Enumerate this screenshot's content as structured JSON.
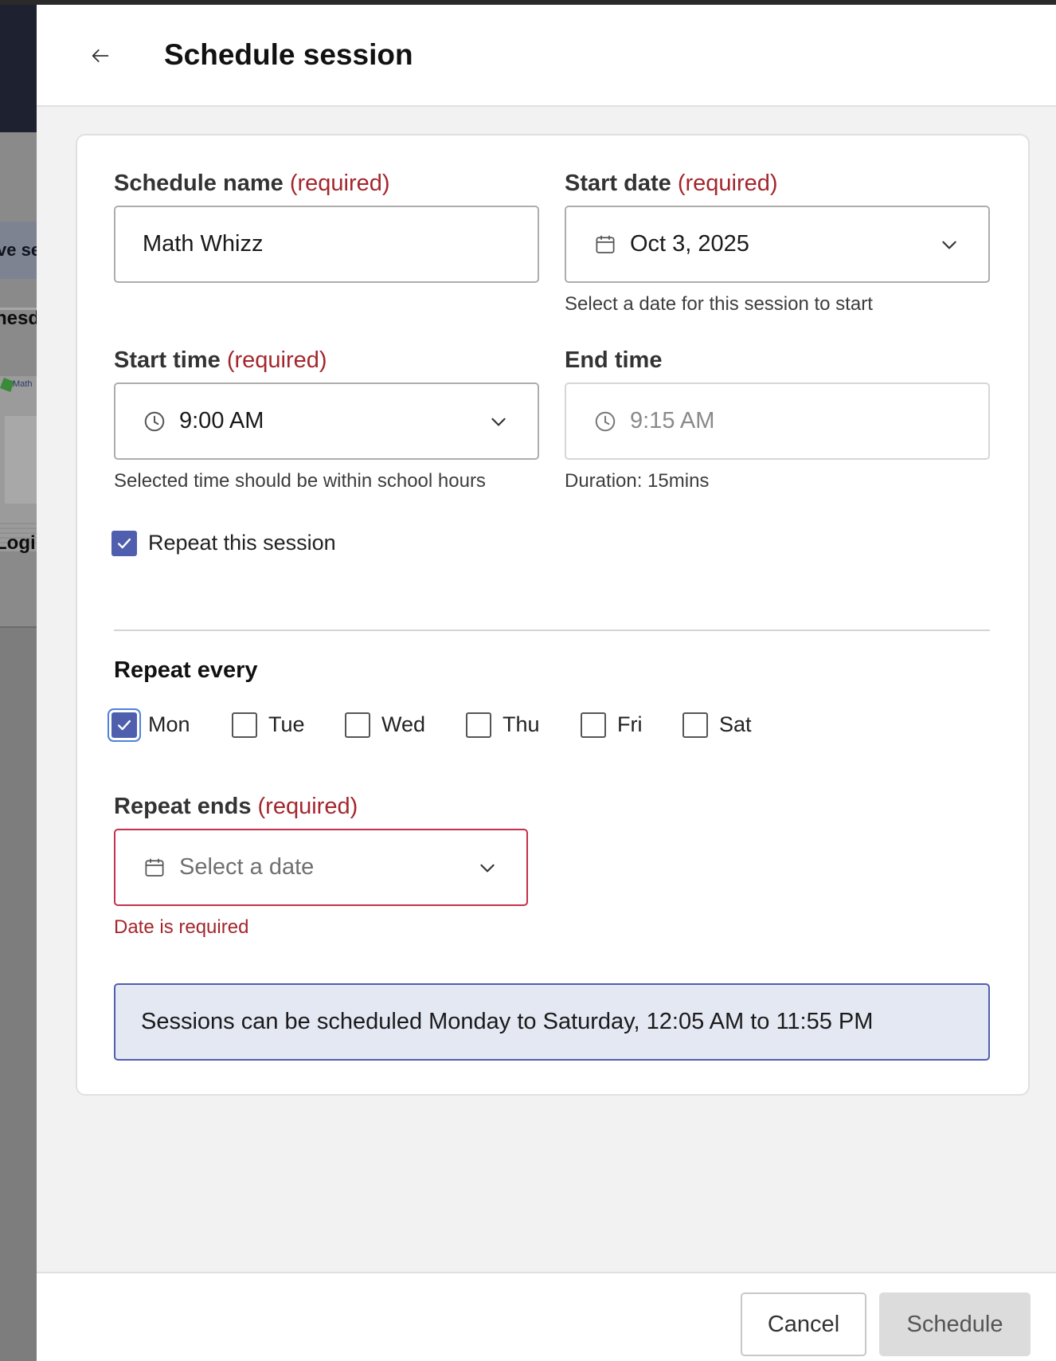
{
  "background_app": {
    "partial_button": "ve se",
    "partial_heading": "nesd",
    "partial_logo_text": "Math",
    "partial_login": "Logi"
  },
  "header": {
    "back_icon": "arrow-left-icon",
    "title": "Schedule session"
  },
  "form": {
    "schedule_name": {
      "label": "Schedule name",
      "required": "(required)",
      "value": "Math Whizz"
    },
    "start_date": {
      "label": "Start date",
      "required": "(required)",
      "value": "Oct 3, 2025",
      "icon": "calendar-icon",
      "hint": "Select a date for this session to start"
    },
    "start_time": {
      "label": "Start time",
      "required": "(required)",
      "value": "9:00 AM",
      "icon": "clock-icon",
      "hint": "Selected time should be within school hours"
    },
    "end_time": {
      "label": "End time",
      "value": "9:15 AM",
      "icon": "clock-icon",
      "hint": "Duration: 15mins"
    },
    "repeat_checkbox": {
      "label": "Repeat this session",
      "checked": true
    },
    "repeat_every": {
      "title": "Repeat every",
      "days": [
        {
          "label": "Mon",
          "checked": true
        },
        {
          "label": "Tue",
          "checked": false
        },
        {
          "label": "Wed",
          "checked": false
        },
        {
          "label": "Thu",
          "checked": false
        },
        {
          "label": "Fri",
          "checked": false
        },
        {
          "label": "Sat",
          "checked": false
        }
      ]
    },
    "repeat_ends": {
      "label": "Repeat ends",
      "required": "(required)",
      "placeholder": "Select a date",
      "icon": "calendar-icon",
      "error": "Date is required"
    },
    "info_banner": "Sessions can be scheduled Monday to Saturday, 12:05 AM to 11:55 PM"
  },
  "footer": {
    "cancel_label": "Cancel",
    "schedule_label": "Schedule"
  },
  "colors": {
    "accent": "#4f5fae",
    "error": "#a4262c",
    "info_bg": "#e4e8f3"
  }
}
